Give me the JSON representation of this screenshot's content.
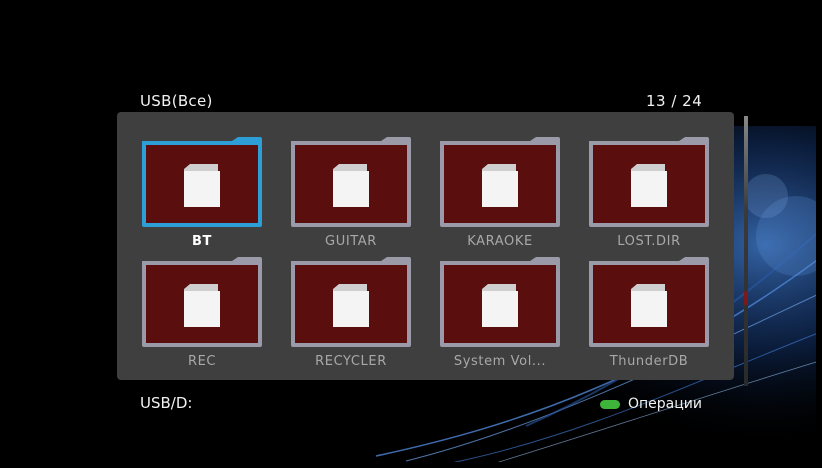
{
  "header": {
    "title": "USB(Все)",
    "counter": "13 / 24"
  },
  "grid": {
    "selected_index": 0,
    "items": [
      {
        "label": "BT",
        "icon": "folder-icon"
      },
      {
        "label": "GUITAR",
        "icon": "folder-icon"
      },
      {
        "label": "KARAOKE",
        "icon": "folder-icon"
      },
      {
        "label": "LOST.DIR",
        "icon": "folder-icon"
      },
      {
        "label": "REC",
        "icon": "folder-icon"
      },
      {
        "label": "RECYCLER",
        "icon": "folder-icon"
      },
      {
        "label": "System Vol...",
        "icon": "folder-icon"
      },
      {
        "label": "ThunderDB",
        "icon": "folder-icon"
      }
    ]
  },
  "footer": {
    "path": "USB/D:",
    "operations_label": "Операции"
  },
  "colors": {
    "background": "#000000",
    "panel": "#3f3f3f",
    "selection": "#2e9fd6",
    "thumb_fill": "#5a0e0e",
    "green_key": "#3fb43a"
  }
}
